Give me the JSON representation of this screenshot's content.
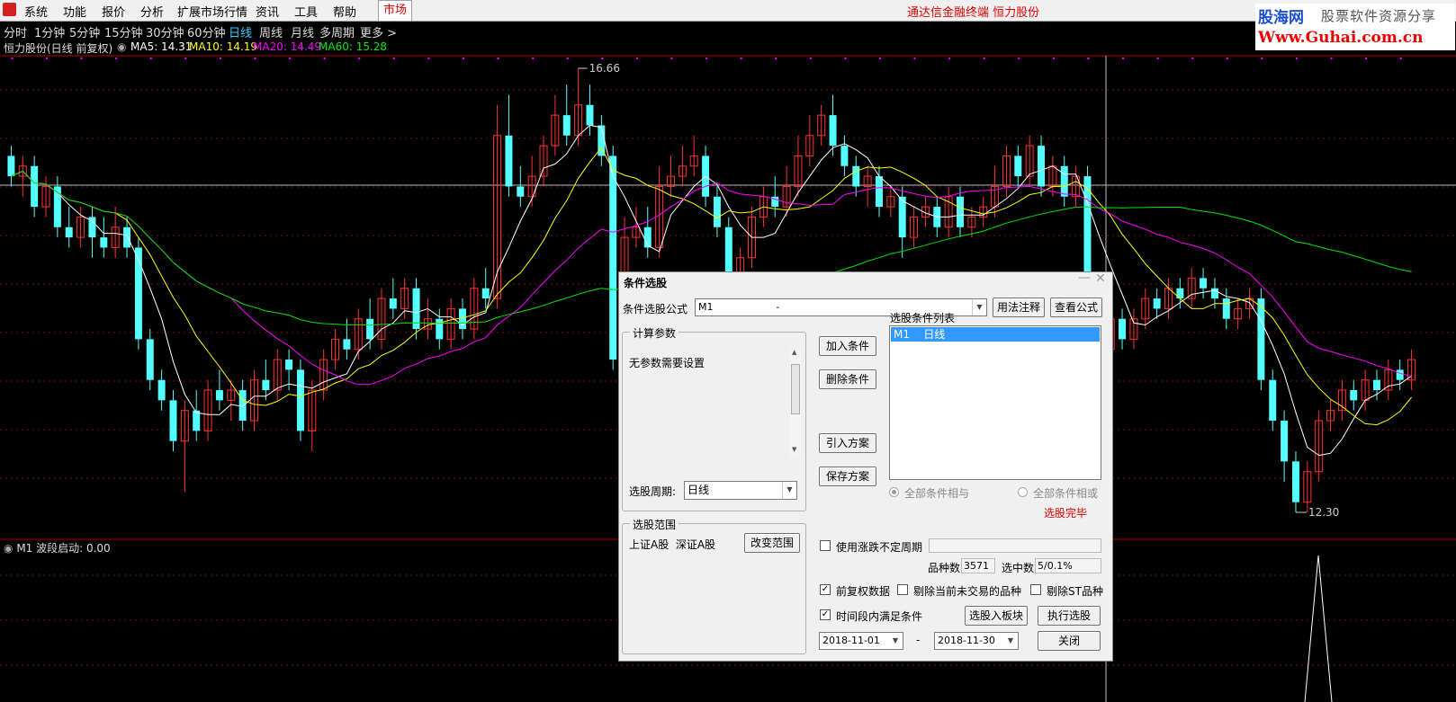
{
  "menu": [
    "系统",
    "功能",
    "报价",
    "分析",
    "扩展市场行情",
    "资讯",
    "工具",
    "帮助"
  ],
  "market_tab": "市场",
  "app_title": "通达信金融终端  恒力股份",
  "watermark": {
    "line1": "股海网",
    "line2": "股票软件资源分享",
    "line3": "Www.Guhai.com.cn"
  },
  "periods": [
    "分时",
    "1分钟",
    "5分钟",
    "15分钟",
    "30分钟",
    "60分钟",
    "日线",
    "周线",
    "月线",
    "多周期",
    "更多 >"
  ],
  "active_period": "日线",
  "info": {
    "stock": "恒力股份(日线 前复权)",
    "ma5": "MA5: 14.31",
    "ma10": "MA10: 14.19",
    "ma20": "MA20: 14.49",
    "ma60": "MA60: 15.28"
  },
  "chart_labels": {
    "high": "16.66",
    "low": "12.30"
  },
  "indicator_label": "M1  波段启动: 0.00",
  "colors": {
    "up": "#ff3232",
    "down": "#54ffff",
    "ma5": "#ffffff",
    "ma10": "#ffff00",
    "ma20": "#ff00ff",
    "ma60": "#00e000"
  },
  "dialog": {
    "title": "条件选股",
    "formula_label": "条件选股公式",
    "formula_value": "M1                    -",
    "btn_usage": "用法注释",
    "btn_view": "查看公式",
    "params_group": "计算参数",
    "params_text": "无参数需要设置",
    "period_label": "选股周期:",
    "period_value": "日线",
    "btn_add": "加入条件",
    "btn_delete": "删除条件",
    "btn_import": "引入方案",
    "btn_save": "保存方案",
    "list_title": "选股条件列表",
    "list_items": [
      "M1    日线"
    ],
    "radio_and": "全部条件相与",
    "radio_or": "全部条件相或",
    "status": "选股完毕",
    "scope_group": "选股范围",
    "scope_text": "上证A股  深证A股",
    "btn_scope": "改变范围",
    "cb_variable": "使用涨跌不定周期",
    "count_label": "品种数",
    "count_value": "3571",
    "selected_label": "选中数",
    "selected_value": "5/0.1%",
    "cb_restore": "前复权数据",
    "cb_exclude_untraded": "剔除当前未交易的品种",
    "cb_exclude_st": "剔除ST品种",
    "cb_timerange": "时间段内满足条件",
    "btn_to_block": "选股入板块",
    "btn_execute": "执行选股",
    "date_from": "2018-11-01",
    "date_sep": "-",
    "date_to": "2018-11-30",
    "btn_close": "关闭"
  },
  "chart_data": {
    "type": "candlestick",
    "ylim": [
      12.3,
      16.66
    ],
    "candles": [
      [
        15.8,
        15.6,
        15.9,
        15.5
      ],
      [
        15.6,
        15.7,
        15.8,
        15.4
      ],
      [
        15.7,
        15.3,
        15.8,
        15.2
      ],
      [
        15.3,
        15.5,
        15.6,
        15.2
      ],
      [
        15.5,
        15.1,
        15.6,
        15.0
      ],
      [
        15.1,
        15.0,
        15.3,
        14.9
      ],
      [
        15.0,
        15.2,
        15.3,
        14.9
      ],
      [
        15.2,
        15.0,
        15.3,
        14.8
      ],
      [
        15.0,
        14.9,
        15.2,
        14.8
      ],
      [
        14.9,
        15.1,
        15.3,
        14.8
      ],
      [
        15.1,
        14.9,
        15.2,
        14.8
      ],
      [
        14.9,
        14.0,
        15.0,
        13.9
      ],
      [
        14.0,
        13.6,
        14.1,
        13.5
      ],
      [
        13.6,
        13.4,
        13.7,
        13.3
      ],
      [
        13.4,
        13.0,
        13.5,
        12.9
      ],
      [
        13.0,
        13.3,
        13.4,
        12.5
      ],
      [
        13.3,
        13.1,
        13.5,
        13.0
      ],
      [
        13.1,
        13.5,
        13.6,
        13.0
      ],
      [
        13.5,
        13.4,
        13.7,
        13.3
      ],
      [
        13.4,
        13.5,
        13.6,
        13.2
      ],
      [
        13.5,
        13.2,
        13.6,
        13.1
      ],
      [
        13.2,
        13.6,
        13.7,
        13.1
      ],
      [
        13.6,
        13.5,
        13.8,
        13.4
      ],
      [
        13.5,
        13.8,
        13.9,
        13.4
      ],
      [
        13.8,
        13.7,
        13.9,
        13.5
      ],
      [
        13.7,
        13.1,
        13.8,
        13.0
      ],
      [
        13.1,
        13.5,
        13.6,
        12.9
      ],
      [
        13.5,
        13.8,
        13.9,
        13.4
      ],
      [
        13.8,
        14.0,
        14.1,
        13.7
      ],
      [
        14.0,
        13.9,
        14.2,
        13.8
      ],
      [
        13.9,
        14.2,
        14.3,
        13.8
      ],
      [
        14.2,
        14.0,
        14.4,
        13.9
      ],
      [
        14.0,
        14.4,
        14.5,
        13.9
      ],
      [
        14.4,
        14.3,
        14.6,
        14.2
      ],
      [
        14.3,
        14.5,
        14.6,
        14.2
      ],
      [
        14.5,
        14.1,
        14.6,
        14.0
      ],
      [
        14.1,
        14.2,
        14.4,
        14.0
      ],
      [
        14.2,
        14.0,
        14.3,
        13.9
      ],
      [
        14.0,
        14.3,
        14.4,
        13.9
      ],
      [
        14.3,
        14.1,
        14.4,
        14.0
      ],
      [
        14.1,
        14.5,
        14.6,
        14.0
      ],
      [
        14.5,
        14.4,
        14.7,
        14.3
      ],
      [
        14.4,
        16.0,
        16.3,
        14.3
      ],
      [
        16.0,
        15.5,
        16.4,
        15.4
      ],
      [
        15.5,
        15.4,
        15.7,
        15.3
      ],
      [
        15.4,
        15.6,
        15.8,
        15.3
      ],
      [
        15.6,
        15.9,
        16.0,
        15.5
      ],
      [
        15.9,
        16.2,
        16.4,
        15.8
      ],
      [
        16.2,
        16.0,
        16.5,
        15.9
      ],
      [
        16.0,
        16.3,
        16.66,
        15.9
      ],
      [
        16.3,
        16.1,
        16.5,
        16.0
      ],
      [
        16.1,
        15.8,
        16.2,
        15.7
      ],
      [
        15.8,
        13.8,
        15.9,
        13.7
      ],
      [
        13.8,
        15.0,
        15.2,
        13.6
      ],
      [
        15.0,
        15.1,
        15.3,
        14.9
      ],
      [
        15.1,
        14.9,
        15.3,
        14.8
      ],
      [
        14.9,
        15.5,
        15.7,
        14.8
      ],
      [
        15.5,
        15.6,
        15.8,
        15.4
      ],
      [
        15.6,
        15.7,
        15.9,
        15.5
      ],
      [
        15.7,
        15.8,
        16.0,
        15.6
      ],
      [
        15.8,
        15.4,
        15.9,
        15.3
      ],
      [
        15.4,
        15.1,
        15.5,
        15.0
      ],
      [
        15.1,
        14.5,
        15.2,
        14.3
      ],
      [
        14.5,
        14.8,
        14.9,
        14.4
      ],
      [
        14.8,
        15.2,
        15.3,
        14.7
      ],
      [
        15.2,
        15.4,
        15.5,
        15.1
      ],
      [
        15.4,
        15.3,
        15.6,
        15.2
      ],
      [
        15.3,
        15.5,
        15.7,
        15.2
      ],
      [
        15.5,
        15.8,
        16.0,
        15.4
      ],
      [
        15.8,
        16.0,
        16.2,
        15.7
      ],
      [
        16.0,
        16.2,
        16.3,
        15.9
      ],
      [
        16.2,
        15.9,
        16.4,
        15.8
      ],
      [
        15.9,
        15.7,
        16.0,
        15.6
      ],
      [
        15.7,
        15.5,
        15.8,
        15.4
      ],
      [
        15.5,
        15.6,
        15.7,
        15.3
      ],
      [
        15.6,
        15.3,
        15.7,
        15.2
      ],
      [
        15.3,
        15.4,
        15.5,
        15.2
      ],
      [
        15.4,
        15.0,
        15.5,
        14.8
      ],
      [
        15.0,
        15.2,
        15.3,
        14.9
      ],
      [
        15.2,
        15.3,
        15.4,
        15.1
      ],
      [
        15.3,
        15.1,
        15.4,
        15.0
      ],
      [
        15.1,
        15.4,
        15.5,
        15.0
      ],
      [
        15.4,
        15.1,
        15.5,
        15.0
      ],
      [
        15.1,
        15.2,
        15.3,
        15.0
      ],
      [
        15.2,
        15.3,
        15.4,
        15.1
      ],
      [
        15.3,
        15.5,
        15.7,
        15.2
      ],
      [
        15.5,
        15.8,
        15.9,
        15.4
      ],
      [
        15.8,
        15.6,
        15.9,
        15.5
      ],
      [
        15.6,
        15.9,
        16.0,
        15.5
      ],
      [
        15.9,
        15.5,
        16.0,
        15.4
      ],
      [
        15.5,
        15.7,
        15.8,
        15.4
      ],
      [
        15.7,
        15.4,
        15.8,
        15.3
      ],
      [
        15.4,
        15.6,
        15.7,
        15.3
      ],
      [
        15.6,
        14.5,
        15.7,
        14.4
      ],
      [
        14.5,
        13.9,
        14.6,
        13.8
      ],
      [
        13.9,
        14.2,
        14.3,
        13.8
      ],
      [
        14.2,
        14.0,
        14.3,
        13.9
      ],
      [
        14.0,
        14.2,
        14.3,
        13.9
      ],
      [
        14.2,
        14.4,
        14.5,
        14.1
      ],
      [
        14.4,
        14.3,
        14.5,
        14.2
      ],
      [
        14.3,
        14.5,
        14.6,
        14.2
      ],
      [
        14.5,
        14.4,
        14.6,
        14.3
      ],
      [
        14.4,
        14.6,
        14.7,
        14.3
      ],
      [
        14.6,
        14.5,
        14.7,
        14.4
      ],
      [
        14.5,
        14.4,
        14.6,
        14.3
      ],
      [
        14.4,
        14.2,
        14.5,
        14.1
      ],
      [
        14.2,
        14.3,
        14.4,
        14.1
      ],
      [
        14.3,
        14.4,
        14.5,
        14.2
      ],
      [
        14.4,
        13.6,
        14.5,
        13.5
      ],
      [
        13.6,
        13.2,
        13.7,
        13.1
      ],
      [
        13.2,
        12.8,
        13.3,
        12.6
      ],
      [
        12.8,
        12.4,
        12.9,
        12.3
      ],
      [
        12.4,
        12.7,
        12.8,
        12.3
      ],
      [
        12.7,
        13.2,
        13.3,
        12.6
      ],
      [
        13.2,
        13.3,
        13.4,
        13.1
      ],
      [
        13.3,
        13.5,
        13.6,
        13.2
      ],
      [
        13.5,
        13.4,
        13.6,
        13.3
      ],
      [
        13.4,
        13.6,
        13.7,
        13.3
      ],
      [
        13.6,
        13.5,
        13.7,
        13.4
      ],
      [
        13.5,
        13.7,
        13.8,
        13.4
      ],
      [
        13.7,
        13.6,
        13.8,
        13.5
      ],
      [
        13.6,
        13.8,
        13.9,
        13.5
      ]
    ]
  }
}
